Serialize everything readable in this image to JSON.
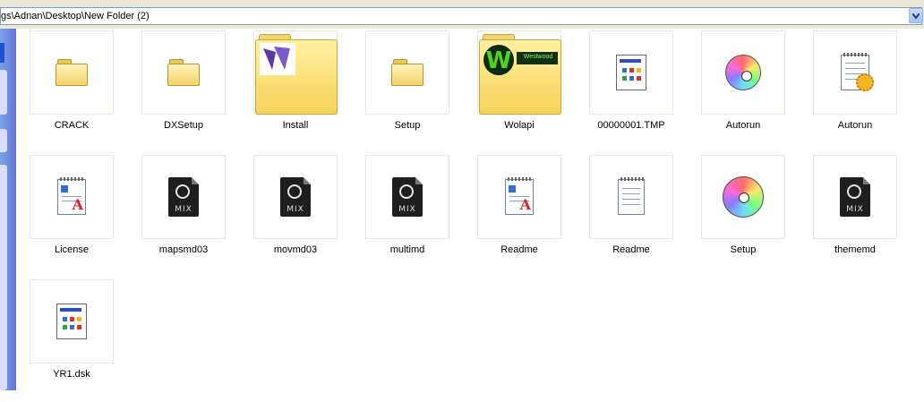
{
  "address_bar": {
    "path": "gs\\Adnan\\Desktop\\New Folder (2)"
  },
  "items": [
    {
      "name": "CRACK",
      "icon": "folder-icon"
    },
    {
      "name": "DXSetup",
      "icon": "folder-icon"
    },
    {
      "name": "Install",
      "icon": "folder-thumbnail-icon"
    },
    {
      "name": "Setup",
      "icon": "folder-icon"
    },
    {
      "name": "Wolapi",
      "icon": "folder-thumbnail-icon"
    },
    {
      "name": "00000001.TMP",
      "icon": "system-file-icon"
    },
    {
      "name": "Autorun",
      "icon": "cd-autorun-icon"
    },
    {
      "name": "Autorun",
      "icon": "config-settings-icon"
    },
    {
      "name": "License",
      "icon": "wordpad-document-icon"
    },
    {
      "name": "mapsmd03",
      "icon": "mix-file-icon"
    },
    {
      "name": "movmd03",
      "icon": "mix-file-icon"
    },
    {
      "name": "multimd",
      "icon": "mix-file-icon"
    },
    {
      "name": "Readme",
      "icon": "wordpad-document-icon"
    },
    {
      "name": "Readme",
      "icon": "notepad-text-icon"
    },
    {
      "name": "Setup",
      "icon": "cd-setup-icon"
    },
    {
      "name": "thememd",
      "icon": "mix-file-icon"
    },
    {
      "name": "YR1.dsk",
      "icon": "system-file-icon"
    }
  ],
  "mix_label": "MIX",
  "wolapi_banner": "Westwood",
  "colors": {
    "window_face": "#ece9d8",
    "address_border": "#7f9db9",
    "task_pane_blue": "#6375d6",
    "thumb_border": "#eae8d6"
  }
}
